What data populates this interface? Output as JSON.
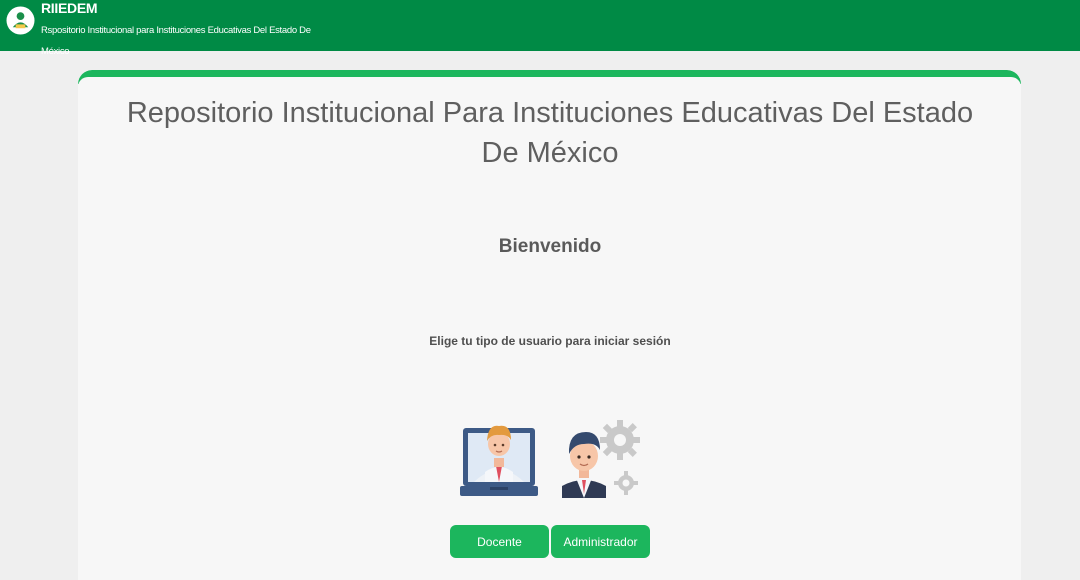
{
  "header": {
    "brand": "RIIEDEM",
    "subtitle": "Rspositorio Institucional para Instituciones Educativas Del Estado De México"
  },
  "main": {
    "title": "Repositorio Institucional Para Instituciones Educativas Del Estado De México",
    "welcome": "Bienvenido",
    "prompt": "Elige tu tipo de usuario para iniciar sesión"
  },
  "users": [
    {
      "label": "Docente",
      "icon": "teacher-laptop-icon"
    },
    {
      "label": "Administrador",
      "icon": "administrator-gears-icon"
    }
  ],
  "colors": {
    "header_bg": "#008a45",
    "accent": "#1cb65d",
    "card_bg": "#f7f7f7",
    "page_bg": "#efefef"
  }
}
